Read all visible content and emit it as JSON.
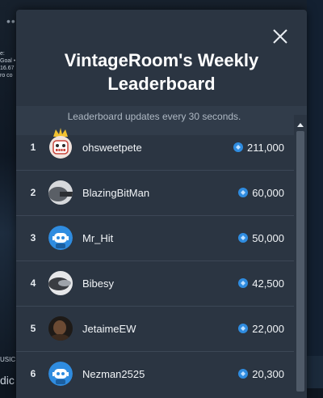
{
  "background": {
    "dots": "•••",
    "stat_lines": [
      "e:",
      "Goal •",
      "16.67",
      "ro co"
    ],
    "music": "USIC",
    "dic": "dic"
  },
  "modal": {
    "title_line1": "VintageRoom's Weekly",
    "title_line2": "Leaderboard",
    "subtitle": "Leaderboard updates every 30 seconds.",
    "close_icon": "close-icon"
  },
  "leaderboard": [
    {
      "rank": "1",
      "user": "ohsweetpete",
      "points": "211,000",
      "avatar": "robot-crown-avatar"
    },
    {
      "rank": "2",
      "user": "BlazingBitMan",
      "points": "60,000",
      "avatar": "photo-avatar"
    },
    {
      "rank": "3",
      "user": "Mr_Hit",
      "points": "50,000",
      "avatar": "default-robot-avatar"
    },
    {
      "rank": "4",
      "user": "Bibesy",
      "points": "42,500",
      "avatar": "photo-avatar"
    },
    {
      "rank": "5",
      "user": "JetaimeEW",
      "points": "22,000",
      "avatar": "photo-avatar"
    },
    {
      "rank": "6",
      "user": "Nezman2525",
      "points": "20,300",
      "avatar": "default-robot-avatar"
    }
  ],
  "colors": {
    "modal_bg": "#2b3542",
    "coin": "#2f8ce0",
    "crown": "#f2c230"
  }
}
